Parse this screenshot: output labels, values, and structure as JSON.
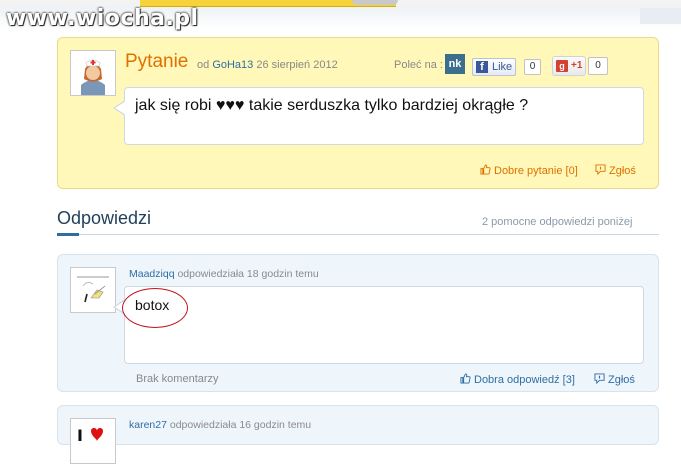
{
  "watermark": "www.wiocha.pl",
  "question": {
    "title": "Pytanie",
    "meta_prefix": "od",
    "author": "GoHa13",
    "date": "26 sierpień 2012",
    "share_label": "Poleć na :",
    "nk_label": "nk",
    "fb_like_label": "Like",
    "fb_count": "0",
    "gplus_label": "+1",
    "gplus_count": "0",
    "text": "jak się robi ♥♥♥ takie serduszka tylko bardziej okrągłe ?",
    "good_question": "Dobre pytanie [0]",
    "report": "Zgłoś"
  },
  "answers_section": {
    "title": "Odpowiedzi",
    "summary": "2 pomocne odpowiedzi poniżej"
  },
  "answers": [
    {
      "author": "Maadziqq",
      "meta": "odpowiedziała 18 godzin temu",
      "text": "botox",
      "comments": "Brak komentarzy",
      "good_answer": "Dobra odpowiedź [3]",
      "report": "Zgłoś"
    },
    {
      "author": "karen27",
      "meta": "odpowiedziała 16 godzin temu"
    }
  ],
  "colors": {
    "accent_orange": "#e07000",
    "link_blue": "#2f6ea3",
    "question_bg": "#fff8b8",
    "answer_bg": "#eef5fb",
    "annotation_red": "#c1121f"
  }
}
